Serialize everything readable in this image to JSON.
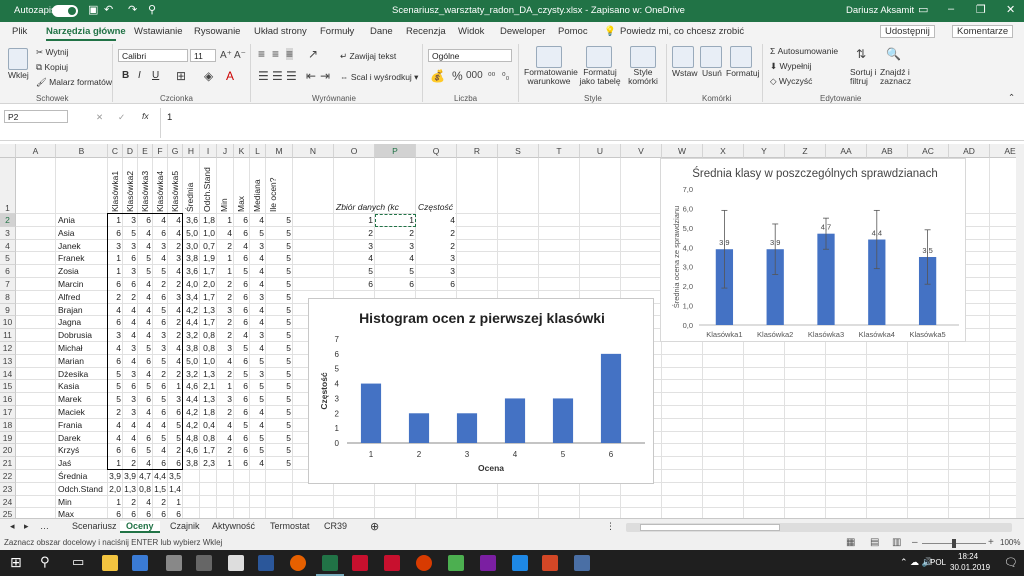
{
  "titlebar": {
    "autosave_label": "Autozapis",
    "filename": "Scenariusz_warsztaty_radon_DA_czysty.xlsx - Zapisano w: OneDrive",
    "user": "Dariusz Aksamit"
  },
  "menu": {
    "tabs": [
      "Plik",
      "Narzędzia główne",
      "Wstawianie",
      "Rysowanie",
      "Układ strony",
      "Formuły",
      "Dane",
      "Recenzja",
      "Widok",
      "Deweloper",
      "Pomoc"
    ],
    "search": "Powiedz mi, co chcesz zrobić",
    "share": "Udostępnij",
    "comments": "Komentarze"
  },
  "ribbon": {
    "clipboard": {
      "paste": "Wklej",
      "cut": "Wytnij",
      "copy": "Kopiuj",
      "painter": "Malarz formatów",
      "group": "Schowek"
    },
    "font": {
      "name": "Calibri",
      "size": "11",
      "bold": "B",
      "italic": "I",
      "underline": "U",
      "group": "Czcionka"
    },
    "alignment": {
      "wrap": "Zawijaj tekst",
      "merge": "Scal i wyśrodkuj",
      "group": "Wyrównanie"
    },
    "number": {
      "format": "Ogólne",
      "group": "Liczba"
    },
    "styles": {
      "cond": "Formatowanie warunkowe",
      "table": "Formatuj jako tabelę",
      "cell": "Style komórki",
      "group": "Style"
    },
    "cells": {
      "insert": "Wstaw",
      "delete": "Usuń",
      "format": "Formatuj",
      "group": "Komórki"
    },
    "editing": {
      "autosum": "Autosumowanie",
      "fill": "Wypełnij",
      "clear": "Wyczyść",
      "sort": "Sortuj i filtruj",
      "find": "Znajdź i zaznacz",
      "group": "Edytowanie"
    }
  },
  "formula": {
    "namebox": "P2",
    "fx": "fx",
    "value": "1"
  },
  "columns": [
    "A",
    "B",
    "C",
    "D",
    "E",
    "F",
    "G",
    "H",
    "I",
    "J",
    "K",
    "L",
    "M",
    "N",
    "O",
    "P",
    "Q",
    "R",
    "S",
    "T",
    "U",
    "V",
    "W",
    "X",
    "Y",
    "Z",
    "AA",
    "AB",
    "AC",
    "AD",
    "AE"
  ],
  "headers": [
    "Klasówka1",
    "Klasówka2",
    "Klasówka3",
    "Klasówka4",
    "Klasówka5",
    "Średnia",
    "Odch.Stand",
    "Min",
    "Max",
    "Mediana",
    "Ile ocen?"
  ],
  "students": [
    {
      "name": "Ania",
      "v": [
        "1",
        "3",
        "6",
        "4",
        "4",
        "3,6",
        "1,8",
        "1",
        "6",
        "4",
        "5"
      ]
    },
    {
      "name": "Asia",
      "v": [
        "6",
        "5",
        "4",
        "6",
        "4",
        "5,0",
        "1,0",
        "4",
        "6",
        "5",
        "5"
      ]
    },
    {
      "name": "Janek",
      "v": [
        "3",
        "3",
        "4",
        "3",
        "2",
        "3,0",
        "0,7",
        "2",
        "4",
        "3",
        "5"
      ]
    },
    {
      "name": "Franek",
      "v": [
        "1",
        "6",
        "5",
        "4",
        "3",
        "3,8",
        "1,9",
        "1",
        "6",
        "4",
        "5"
      ]
    },
    {
      "name": "Zosia",
      "v": [
        "1",
        "3",
        "5",
        "5",
        "4",
        "3,6",
        "1,7",
        "1",
        "5",
        "4",
        "5"
      ]
    },
    {
      "name": "Marcin",
      "v": [
        "6",
        "6",
        "4",
        "2",
        "2",
        "4,0",
        "2,0",
        "2",
        "6",
        "4",
        "5"
      ]
    },
    {
      "name": "Alfred",
      "v": [
        "2",
        "2",
        "4",
        "6",
        "3",
        "3,4",
        "1,7",
        "2",
        "6",
        "3",
        "5"
      ]
    },
    {
      "name": "Brajan",
      "v": [
        "4",
        "4",
        "4",
        "5",
        "4",
        "4,2",
        "1,3",
        "3",
        "6",
        "4",
        "5"
      ]
    },
    {
      "name": "Jagna",
      "v": [
        "6",
        "4",
        "4",
        "6",
        "2",
        "4,4",
        "1,7",
        "2",
        "6",
        "4",
        "5"
      ]
    },
    {
      "name": "Dobrusia",
      "v": [
        "3",
        "4",
        "4",
        "3",
        "2",
        "3,2",
        "0,8",
        "2",
        "4",
        "3",
        "5"
      ]
    },
    {
      "name": "Michał",
      "v": [
        "4",
        "3",
        "5",
        "3",
        "4",
        "3,8",
        "0,8",
        "3",
        "5",
        "4",
        "5"
      ]
    },
    {
      "name": "Marian",
      "v": [
        "6",
        "4",
        "6",
        "5",
        "4",
        "5,0",
        "1,0",
        "4",
        "6",
        "5",
        "5"
      ]
    },
    {
      "name": "Dżesika",
      "v": [
        "5",
        "3",
        "4",
        "2",
        "2",
        "3,2",
        "1,3",
        "2",
        "5",
        "3",
        "5"
      ]
    },
    {
      "name": "Kasia",
      "v": [
        "5",
        "6",
        "5",
        "6",
        "1",
        "4,6",
        "2,1",
        "1",
        "6",
        "5",
        "5"
      ]
    },
    {
      "name": "Marek",
      "v": [
        "5",
        "3",
        "6",
        "5",
        "3",
        "4,4",
        "1,3",
        "3",
        "6",
        "5",
        "5"
      ]
    },
    {
      "name": "Maciek",
      "v": [
        "2",
        "3",
        "4",
        "6",
        "6",
        "4,2",
        "1,8",
        "2",
        "6",
        "4",
        "5"
      ]
    },
    {
      "name": "Frania",
      "v": [
        "4",
        "4",
        "4",
        "4",
        "5",
        "4,2",
        "0,4",
        "4",
        "5",
        "4",
        "5"
      ]
    },
    {
      "name": "Darek",
      "v": [
        "4",
        "4",
        "6",
        "5",
        "5",
        "4,8",
        "0,8",
        "4",
        "6",
        "5",
        "5"
      ]
    },
    {
      "name": "Krzyś",
      "v": [
        "6",
        "6",
        "5",
        "4",
        "2",
        "4,6",
        "1,7",
        "2",
        "6",
        "5",
        "5"
      ]
    },
    {
      "name": "Jaś",
      "v": [
        "1",
        "2",
        "4",
        "6",
        "6",
        "3,8",
        "2,3",
        "1",
        "6",
        "4",
        "5"
      ]
    }
  ],
  "summary": [
    {
      "label": "Średnia",
      "v": [
        "3,9",
        "3,9",
        "4,7",
        "4,4",
        "3,5"
      ]
    },
    {
      "label": "Odch.Stand",
      "v": [
        "2,0",
        "1,3",
        "0,8",
        "1,5",
        "1,4"
      ]
    },
    {
      "label": "Min",
      "v": [
        "1",
        "2",
        "4",
        "2",
        "1"
      ]
    },
    {
      "label": "Max",
      "v": [
        "6",
        "6",
        "6",
        "6",
        "6"
      ]
    }
  ],
  "freq": {
    "h1": "Zbiór danych (kc",
    "h2": "Częstość",
    "rows": [
      [
        "1",
        "1",
        "4"
      ],
      [
        "2",
        "2",
        "2"
      ],
      [
        "3",
        "3",
        "2"
      ],
      [
        "4",
        "4",
        "3"
      ],
      [
        "5",
        "5",
        "3"
      ],
      [
        "6",
        "6",
        "6"
      ]
    ]
  },
  "chart_data": [
    {
      "type": "bar",
      "title": "Histogram ocen z pierwszej klasówki",
      "xlabel": "Ocena",
      "ylabel": "Częstość",
      "categories": [
        "1",
        "2",
        "3",
        "4",
        "5",
        "6"
      ],
      "values": [
        4,
        2,
        2,
        3,
        3,
        6
      ],
      "ylim": [
        0,
        7
      ],
      "yticks": [
        "0",
        "1",
        "2",
        "3",
        "4",
        "5",
        "6",
        "7"
      ],
      "color": "#4472c4"
    },
    {
      "type": "bar",
      "title": "Średnia klasy w poszczególnych sprawdzianach",
      "xlabel": "",
      "ylabel": "Średnia ocena ze sprawdzianu",
      "categories": [
        "Klasówka1",
        "Klasówka2",
        "Klasówka3",
        "Klasówka4",
        "Klasówka5"
      ],
      "values": [
        3.9,
        3.9,
        4.7,
        4.4,
        3.5
      ],
      "labels": [
        "3,9",
        "3,9",
        "4,7",
        "4,4",
        "3,5"
      ],
      "errors": [
        2.0,
        1.3,
        0.8,
        1.5,
        1.4
      ],
      "ylim": [
        0,
        7
      ],
      "yticks": [
        "0,0",
        "1,0",
        "2,0",
        "3,0",
        "4,0",
        "5,0",
        "6,0",
        "7,0"
      ],
      "color": "#4472c4"
    }
  ],
  "sheets": [
    "Scenariusz",
    "Oceny",
    "Czajnik",
    "Aktywność",
    "Termostat",
    "CR39"
  ],
  "status": {
    "hint": "Zaznacz obszar docelowy i naciśnij ENTER lub wybierz Wklej",
    "zoom": "100%"
  },
  "taskbar": {
    "lang": "POL",
    "time": "18:24",
    "date": "30.01.2019"
  }
}
